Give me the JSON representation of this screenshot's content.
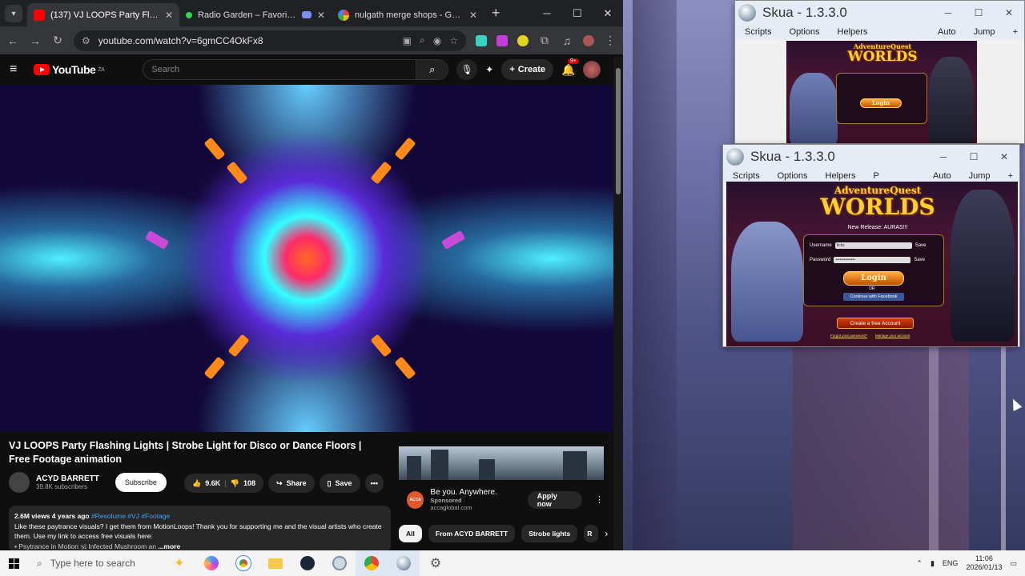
{
  "browser": {
    "tabs": [
      {
        "title": "(137) VJ LOOPS Party Flashing L",
        "color": "#ff0000",
        "active": true
      },
      {
        "title": "Radio Garden – Favorites",
        "color": "#32d74b",
        "active": false
      },
      {
        "title": "",
        "color": "#7a8ff0",
        "active": false
      },
      {
        "title": "nulgath merge shops - Google",
        "color": "#4285f4",
        "active": false
      }
    ],
    "new_tab": "+",
    "url": "youtube.com/watch?v=6gmCC4OkFx8"
  },
  "youtube": {
    "logo": "YouTube",
    "logo_region": "ZA",
    "search_placeholder": "Search",
    "create_label": "Create",
    "notifications": "9+",
    "video_title": "VJ LOOPS Party Flashing Lights | Strobe Light for Disco or Dance Floors | Free Footage animation",
    "channel_name": "ACYD BARRETT",
    "subscribers": "39.8K subscribers",
    "subscribe_label": "Subscribe",
    "likes": "9.6K",
    "dislikes": "108",
    "share_label": "Share",
    "save_label": "Save",
    "description": {
      "views": "2.6M views",
      "age": "4 years ago",
      "hashtags": "#Resolume #VJ #Footage",
      "text": "Like these paytrance visuals? I get them from MotionLoops! Thank you for supporting me and the visual artists who create them. Use my link to access free visuals here:",
      "link_line": "▪ Psytrance in Motion 🕉 Infected Mushroom an",
      "more": "...more"
    },
    "ad": {
      "headline": "Be you. Anywhere.",
      "sponsor_label": "Sponsored",
      "sponsor_domain": "accaglobal.com",
      "logo_text": "ACCA",
      "cta": "Apply now"
    },
    "chips": [
      "All",
      "From ACYD BARRETT",
      "Strobe lights",
      "R"
    ]
  },
  "skua_windows": [
    {
      "title": "Skua - 1.3.3.0",
      "menu": [
        "Scripts",
        "Options",
        "Helpers"
      ],
      "right_menu": [
        "Auto",
        "Jump",
        "+"
      ]
    },
    {
      "title": "Skua - 1.3.3.0",
      "menu": [
        "Scripts",
        "Options",
        "Helpers",
        "P"
      ],
      "right_menu": [
        "Auto",
        "Jump",
        "+"
      ]
    }
  ],
  "game": {
    "logo_line1": "AdventureQuest",
    "logo_line2": "WORLDS",
    "release": "New Release: AURAS!!!",
    "username_label": "Username",
    "password_label": "Password",
    "username_value": "tlctis",
    "password_value": "••••••••••••••",
    "save_label": "Save",
    "login_label": "Login",
    "or_label": "OR",
    "facebook_label": "Continue with Facebook",
    "create_account": "Create a free Account",
    "forgot_password": "Forgot your password?",
    "manage_account": "Manage your account"
  },
  "taskbar": {
    "search_placeholder": "Type here to search",
    "language": "ENG",
    "time": "11:06",
    "date": "2026/01/13"
  }
}
